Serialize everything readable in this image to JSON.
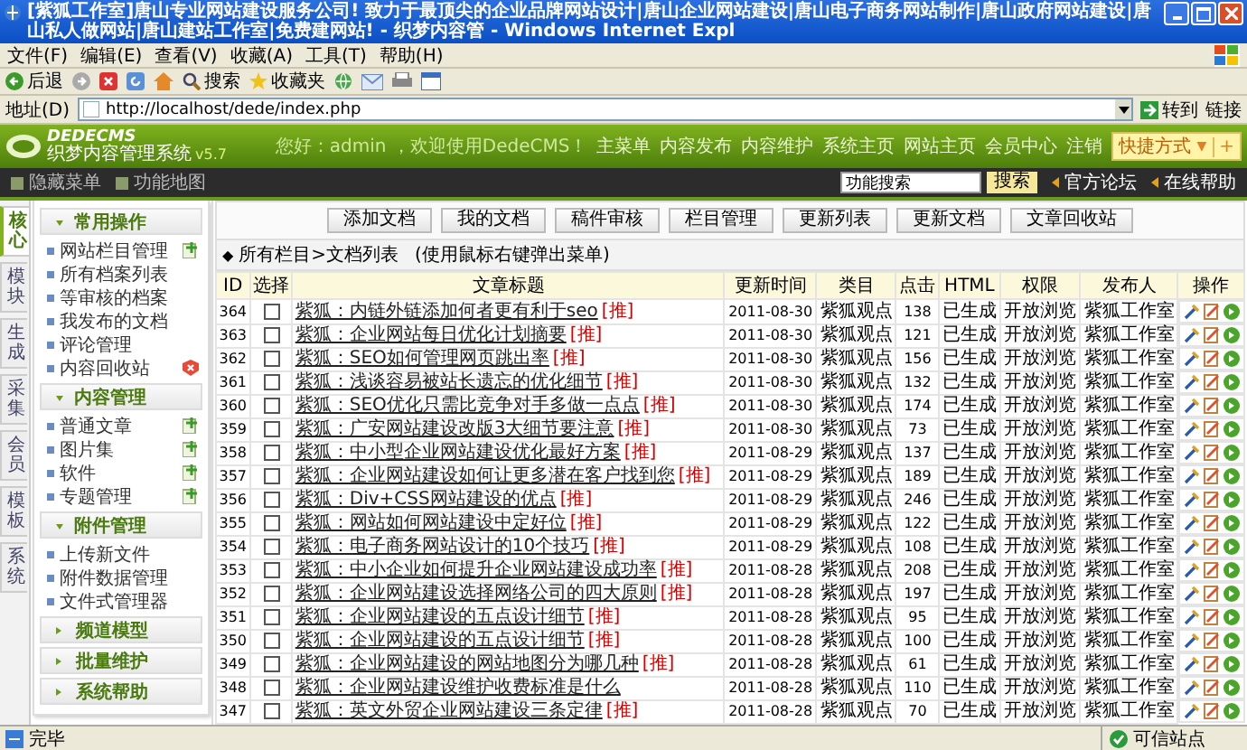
{
  "window": {
    "title": "[紫狐工作室]唐山专业网站建设服务公司! 致力于最顶尖的企业品牌网站设计|唐山企业网站建设|唐山电子商务网站制作|唐山政府网站建设|唐山私人做网站|唐山建站工作室|免费建网站! - 织梦内容管 - Windows Internet Expl"
  },
  "menu_bar": [
    "文件(F)",
    "编辑(E)",
    "查看(V)",
    "收藏(A)",
    "工具(T)",
    "帮助(H)"
  ],
  "toolbar": {
    "back": "后退",
    "search": "搜索",
    "favorites": "收藏夹"
  },
  "address_bar": {
    "label": "地址(D)",
    "value": "http://localhost/dede/index.php",
    "go": "转到",
    "links": "链接"
  },
  "header": {
    "logo": "DEDECMS",
    "subtitle": "织梦内容管理系统",
    "version": "v5.7",
    "greeting": "您好：admin ，欢迎使用DedeCMS！",
    "nav": [
      "主菜单",
      "内容发布",
      "内容维护",
      "系统主页",
      "网站主页",
      "会员中心",
      "注销"
    ],
    "shortcut": "快捷方式",
    "shortcut_caret": "▼",
    "shortcut_add": "+"
  },
  "subbar": {
    "hide_menu": "隐藏菜单",
    "function_map": "功能地图",
    "search_value": "功能搜索",
    "search_button": "搜索",
    "forum": "官方论坛",
    "help": "在线帮助"
  },
  "side_tabs": [
    {
      "label": "核心",
      "selected": true
    },
    {
      "label": "模块",
      "selected": false
    },
    {
      "label": "生成",
      "selected": false
    },
    {
      "label": "采集",
      "selected": false
    },
    {
      "label": "会员",
      "selected": false
    },
    {
      "label": "模板",
      "selected": false
    },
    {
      "label": "系统",
      "selected": false
    }
  ],
  "sidebar": [
    {
      "title": "常用操作",
      "expanded": true,
      "items": [
        {
          "label": "网站栏目管理",
          "kind": "add"
        },
        {
          "label": "所有档案列表",
          "kind": "plain"
        },
        {
          "label": "等审核的档案",
          "kind": "plain"
        },
        {
          "label": "我发布的文档",
          "kind": "plain"
        },
        {
          "label": "评论管理",
          "kind": "plain"
        },
        {
          "label": "内容回收站",
          "kind": "clear"
        }
      ]
    },
    {
      "title": "内容管理",
      "expanded": true,
      "items": [
        {
          "label": "普通文章",
          "kind": "add"
        },
        {
          "label": "图片集",
          "kind": "add"
        },
        {
          "label": "软件",
          "kind": "add"
        },
        {
          "label": "专题管理",
          "kind": "add"
        }
      ]
    },
    {
      "title": "附件管理",
      "expanded": true,
      "items": [
        {
          "label": "上传新文件",
          "kind": "plain"
        },
        {
          "label": "附件数据管理",
          "kind": "plain"
        },
        {
          "label": "文件式管理器",
          "kind": "plain"
        }
      ]
    },
    {
      "title": "频道模型",
      "expanded": false
    },
    {
      "title": "批量维护",
      "expanded": false
    },
    {
      "title": "系统帮助",
      "expanded": false
    }
  ],
  "action_buttons": [
    "添加文档",
    "我的文档",
    "稿件审核",
    "栏目管理",
    "更新列表",
    "更新文档",
    "文章回收站"
  ],
  "caption": {
    "marker": "◆",
    "path": "所有栏目>文档列表",
    "hint": "(使用鼠标右键弹出菜单)"
  },
  "table": {
    "columns": [
      "ID",
      "选择",
      "文章标题",
      "更新时间",
      "类目",
      "点击",
      "HTML",
      "权限",
      "发布人",
      "操作"
    ],
    "rows": [
      {
        "id": "364",
        "checked": false,
        "title": "紫狐：内链外链添加何者更有利于seo",
        "tag": "[推]",
        "time": "2011-08-30",
        "category": "紫狐观点",
        "clicks": "138",
        "html": "已生成",
        "access": "开放浏览",
        "author": "紫狐工作室"
      },
      {
        "id": "363",
        "checked": false,
        "title": "紫狐：企业网站每日优化计划摘要",
        "tag": "[推]",
        "time": "2011-08-30",
        "category": "紫狐观点",
        "clicks": "121",
        "html": "已生成",
        "access": "开放浏览",
        "author": "紫狐工作室"
      },
      {
        "id": "362",
        "checked": false,
        "title": "紫狐：SEO如何管理网页跳出率",
        "tag": "[推]",
        "time": "2011-08-30",
        "category": "紫狐观点",
        "clicks": "156",
        "html": "已生成",
        "access": "开放浏览",
        "author": "紫狐工作室"
      },
      {
        "id": "361",
        "checked": false,
        "title": "紫狐：浅谈容易被站长遗忘的优化细节",
        "tag": "[推]",
        "time": "2011-08-30",
        "category": "紫狐观点",
        "clicks": "132",
        "html": "已生成",
        "access": "开放浏览",
        "author": "紫狐工作室"
      },
      {
        "id": "360",
        "checked": false,
        "title": "紫狐：SEO优化只需比竞争对手多做一点点",
        "tag": "[推]",
        "time": "2011-08-30",
        "category": "紫狐观点",
        "clicks": "174",
        "html": "已生成",
        "access": "开放浏览",
        "author": "紫狐工作室"
      },
      {
        "id": "359",
        "checked": false,
        "title": "紫狐：广安网站建设改版3大细节要注意",
        "tag": "[推]",
        "time": "2011-08-30",
        "category": "紫狐观点",
        "clicks": "73",
        "html": "已生成",
        "access": "开放浏览",
        "author": "紫狐工作室"
      },
      {
        "id": "358",
        "checked": false,
        "title": "紫狐：中小型企业网站建设优化最好方案",
        "tag": "[推]",
        "time": "2011-08-29",
        "category": "紫狐观点",
        "clicks": "137",
        "html": "已生成",
        "access": "开放浏览",
        "author": "紫狐工作室"
      },
      {
        "id": "357",
        "checked": false,
        "title": "紫狐：企业网站建设如何让更多潜在客户找到您",
        "tag": "[推]",
        "time": "2011-08-29",
        "category": "紫狐观点",
        "clicks": "189",
        "html": "已生成",
        "access": "开放浏览",
        "author": "紫狐工作室"
      },
      {
        "id": "356",
        "checked": false,
        "title": "紫狐：Div+CSS网站建设的优点",
        "tag": "[推]",
        "time": "2011-08-29",
        "category": "紫狐观点",
        "clicks": "246",
        "html": "已生成",
        "access": "开放浏览",
        "author": "紫狐工作室"
      },
      {
        "id": "355",
        "checked": false,
        "title": "紫狐：网站如何网站建设中定好位",
        "tag": "[推]",
        "time": "2011-08-29",
        "category": "紫狐观点",
        "clicks": "122",
        "html": "已生成",
        "access": "开放浏览",
        "author": "紫狐工作室"
      },
      {
        "id": "354",
        "checked": false,
        "title": "紫狐：电子商务网站设计的10个技巧",
        "tag": "[推]",
        "time": "2011-08-29",
        "category": "紫狐观点",
        "clicks": "108",
        "html": "已生成",
        "access": "开放浏览",
        "author": "紫狐工作室"
      },
      {
        "id": "353",
        "checked": false,
        "title": "紫狐：中小企业如何提升企业网站建设成功率",
        "tag": "[推]",
        "time": "2011-08-28",
        "category": "紫狐观点",
        "clicks": "208",
        "html": "已生成",
        "access": "开放浏览",
        "author": "紫狐工作室"
      },
      {
        "id": "352",
        "checked": false,
        "title": "紫狐：企业网站建设选择网络公司的四大原则",
        "tag": "[推]",
        "time": "2011-08-28",
        "category": "紫狐观点",
        "clicks": "197",
        "html": "已生成",
        "access": "开放浏览",
        "author": "紫狐工作室"
      },
      {
        "id": "351",
        "checked": false,
        "title": "紫狐：企业网站建设的五点设计细节",
        "tag": "[推]",
        "time": "2011-08-28",
        "category": "紫狐观点",
        "clicks": "95",
        "html": "已生成",
        "access": "开放浏览",
        "author": "紫狐工作室"
      },
      {
        "id": "350",
        "checked": false,
        "title": "紫狐：企业网站建设的五点设计细节",
        "tag": "[推]",
        "time": "2011-08-28",
        "category": "紫狐观点",
        "clicks": "100",
        "html": "已生成",
        "access": "开放浏览",
        "author": "紫狐工作室"
      },
      {
        "id": "349",
        "checked": false,
        "title": "紫狐：企业网站建设的网站地图分为哪几种",
        "tag": "[推]",
        "time": "2011-08-28",
        "category": "紫狐观点",
        "clicks": "61",
        "html": "已生成",
        "access": "开放浏览",
        "author": "紫狐工作室"
      },
      {
        "id": "348",
        "checked": false,
        "title": "紫狐：企业网站建设维护收费标准是什么",
        "time": "2011-08-28",
        "category": "紫狐观点",
        "clicks": "110",
        "html": "已生成",
        "access": "开放浏览",
        "author": "紫狐工作室"
      },
      {
        "id": "347",
        "checked": false,
        "title": "紫狐：英文外贸企业网站建设三条定律",
        "tag": "[推]",
        "time": "2011-08-28",
        "category": "紫狐观点",
        "clicks": "70",
        "html": "已生成",
        "access": "开放浏览",
        "author": "紫狐工作室"
      }
    ]
  },
  "status_bar": {
    "text": "完毕",
    "zone": "可信站点"
  }
}
